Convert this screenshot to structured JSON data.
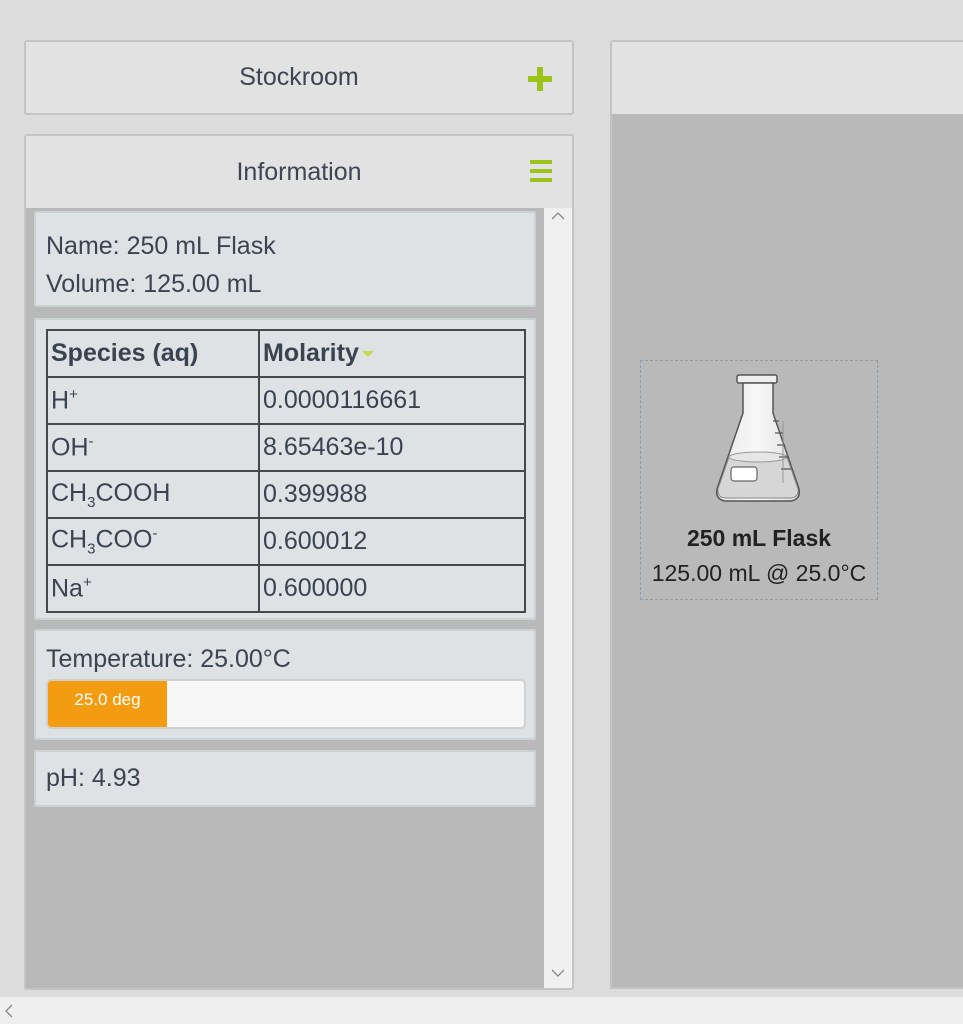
{
  "stockroom": {
    "title": "Stockroom",
    "icon": "plus-icon"
  },
  "information": {
    "title": "Information",
    "icon": "menu-icon",
    "name_line": "Name: 250 mL Flask",
    "volume_line": "Volume: 125.00 mL",
    "table": {
      "headers": {
        "species": "Species (aq)",
        "molarity": "Molarity"
      },
      "rows": [
        {
          "species_base": "H",
          "species_sup": "+",
          "molarity": "0.0000116661"
        },
        {
          "species_base": "OH",
          "species_sup": "-",
          "molarity": "8.65463e-10"
        },
        {
          "species_pre": "CH",
          "species_sub": "3",
          "species_post": "COOH",
          "molarity": "0.399988"
        },
        {
          "species_pre": "CH",
          "species_sub": "3",
          "species_post": "COO",
          "species_sup": "-",
          "molarity": "0.600012"
        },
        {
          "species_base": "Na",
          "species_sup": "+",
          "molarity": "0.600000"
        }
      ]
    },
    "temperature_line": "Temperature: 25.00°C",
    "temperature_bar": {
      "label": "25.0 deg",
      "fraction": 0.25,
      "color": "#f39c12"
    },
    "ph_line": "pH: 4.93"
  },
  "workbench": {
    "flask": {
      "name": "250 mL Flask",
      "status": "125.00 mL @ 25.0°C",
      "icon": "erlenmeyer-flask-icon"
    }
  },
  "colors": {
    "accent": "#9cc31a",
    "temperature": "#f39c12",
    "panel": "#b9b9b9"
  }
}
